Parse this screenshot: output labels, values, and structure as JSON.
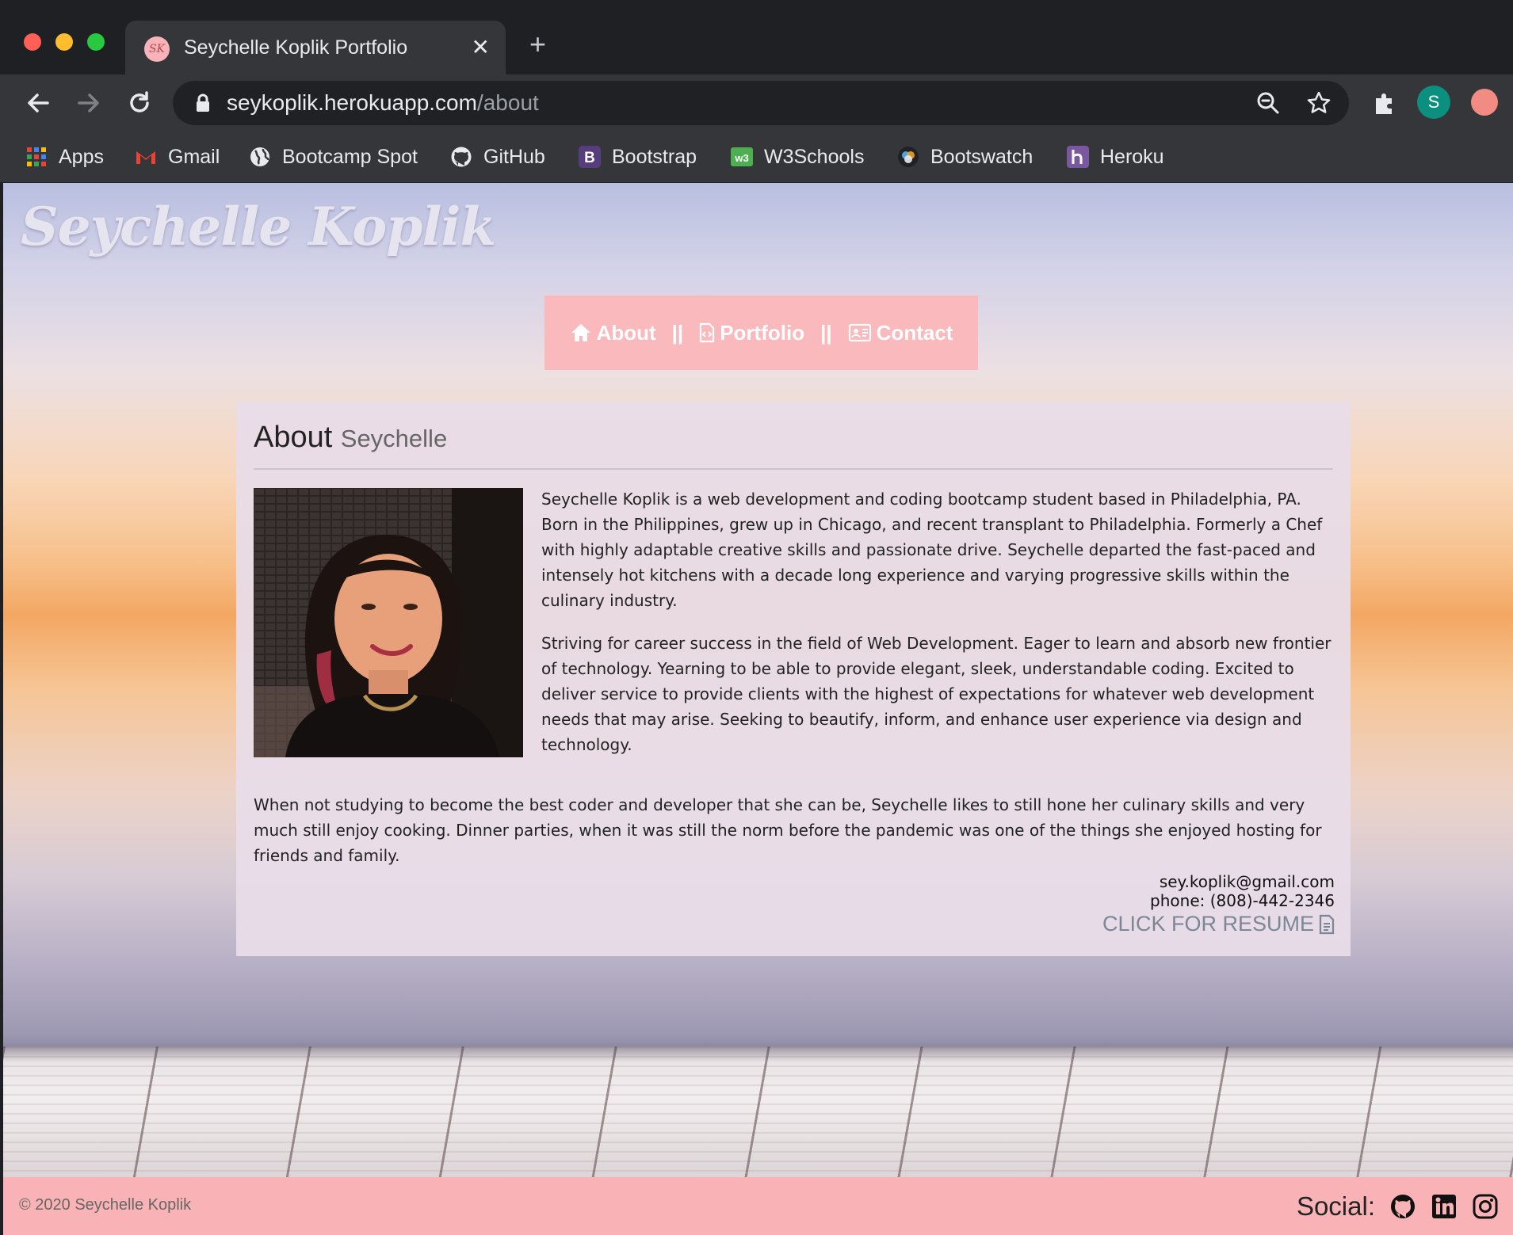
{
  "browser": {
    "tab_title": "Seychelle Koplik Portfolio",
    "favicon_text": "SK",
    "tab_close": "✕",
    "new_tab": "+",
    "url_host": "seykoplik.herokuapp.com",
    "url_path": "/about",
    "profile_initial": "S",
    "bookmarks": [
      "Apps",
      "Gmail",
      "Bootcamp Spot",
      "GitHub",
      "Bootstrap",
      "W3Schools",
      "Bootswatch",
      "Heroku"
    ]
  },
  "site": {
    "title": "Seychelle Koplik",
    "nav": {
      "about": "About",
      "portfolio": "Portfolio",
      "contact": "Contact",
      "separator": "||"
    }
  },
  "about": {
    "heading": "About",
    "subheading": "Seychelle",
    "paragraphs": [
      "Seychelle Koplik is a web development and coding bootcamp student based in Philadelphia, PA. Born in the Philippines, grew up in Chicago, and recent transplant to Philadelphia. Formerly a Chef with highly adaptable creative skills and passionate drive. Seychelle departed the fast-paced and intensely hot kitchens with a decade long experience and varying progressive skills within the culinary industry.",
      "Striving for career success in the field of Web Development. Eager to learn and absorb new frontier of technology. Yearning to be able to provide elegant, sleek, understandable coding. Excited to deliver service to provide clients with the highest of expectations for whatever web development needs that may arise. Seeking to beautify, inform, and enhance user experience via design and technology.",
      "When not studying to become the best coder and developer that she can be, Seychelle likes to still hone her culinary skills and very much still enjoy cooking. Dinner parties, when it was still the norm before the pandemic was one of the things she enjoyed hosting for friends and family."
    ],
    "email": "sey.koplik@gmail.com",
    "phone": "phone: (808)-442-2346",
    "resume_label": "CLICK FOR RESUME"
  },
  "footer": {
    "copyright": "© 2020 Seychelle Koplik",
    "social_label": "Social:"
  },
  "colors": {
    "nav_bg": "#f9b9bd",
    "footer_bg": "#f9b3b6",
    "card_bg": "#e8dce8"
  }
}
